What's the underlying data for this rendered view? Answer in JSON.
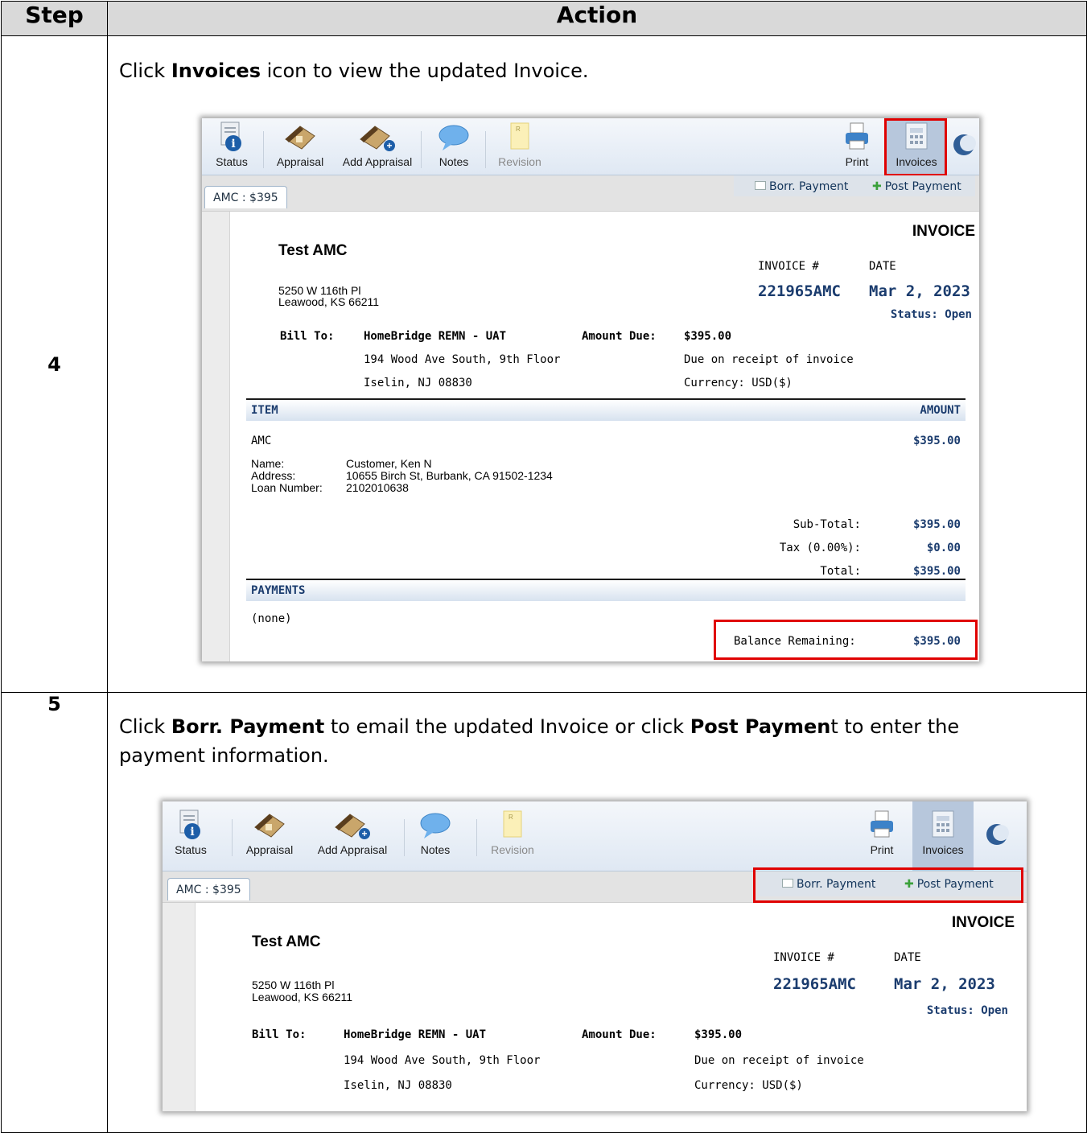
{
  "table": {
    "header_step": "Step",
    "header_action": "Action"
  },
  "step4": {
    "number": "4",
    "instruction_pre": "Click ",
    "instruction_bold": "Invoices",
    "instruction_post": " icon to view the updated Invoice."
  },
  "step5": {
    "number": "5",
    "instruction_pre": "Click ",
    "instruction_bold1": "Borr. Payment",
    "instruction_mid": " to email the updated Invoice or click ",
    "instruction_bold2": "Post Paymen",
    "instruction_post": "t to enter the payment information."
  },
  "toolbar": {
    "status": "Status",
    "appraisal": "Appraisal",
    "add_appraisal": "Add Appraisal",
    "notes": "Notes",
    "revision": "Revision",
    "print": "Print",
    "invoices": "Invoices"
  },
  "tabs": {
    "amc_tab": "AMC : $395",
    "borr_payment": "Borr. Payment",
    "post_payment": "Post Payment"
  },
  "invoice": {
    "heading": "INVOICE",
    "company": "Test AMC",
    "address_line1": "5250 W 116th Pl",
    "address_line2": "Leawood, KS 66211",
    "invoice_no_label": "INVOICE #",
    "date_label": "DATE",
    "invoice_no": "221965AMC",
    "date": "Mar 2, 2023",
    "status": "Status: Open",
    "bill_to_label": "Bill To:",
    "bill_to_name": "HomeBridge REMN - UAT",
    "bill_to_addr1": "194 Wood Ave South, 9th Floor",
    "bill_to_addr2": "Iselin, NJ 08830",
    "amount_due_label": "Amount Due:",
    "amount_due": "$395.00",
    "due_terms": "Due on receipt of invoice",
    "currency": "Currency: USD($)",
    "item_header": "ITEM",
    "amount_header": "AMOUNT",
    "item_name": "AMC",
    "item_amount": "$395.00",
    "name_label": "Name:",
    "name_value": "Customer, Ken N",
    "address_label": "Address:",
    "address_value": "10655 Birch St, Burbank, CA 91502-1234",
    "loan_label": "Loan Number:",
    "loan_value": "2102010638",
    "subtotal_label": "Sub-Total:",
    "subtotal": "$395.00",
    "tax_label": "Tax (0.00%):",
    "tax": "$0.00",
    "total_label": "Total:",
    "total": "$395.00",
    "payments_header": "PAYMENTS",
    "payments_none": "(none)",
    "balance_label": "Balance Remaining:",
    "balance": "$395.00"
  },
  "colors": {
    "highlight_red": "#e00000",
    "invoice_navy": "#1b3c6e",
    "header_gray": "#d9d9d9"
  }
}
